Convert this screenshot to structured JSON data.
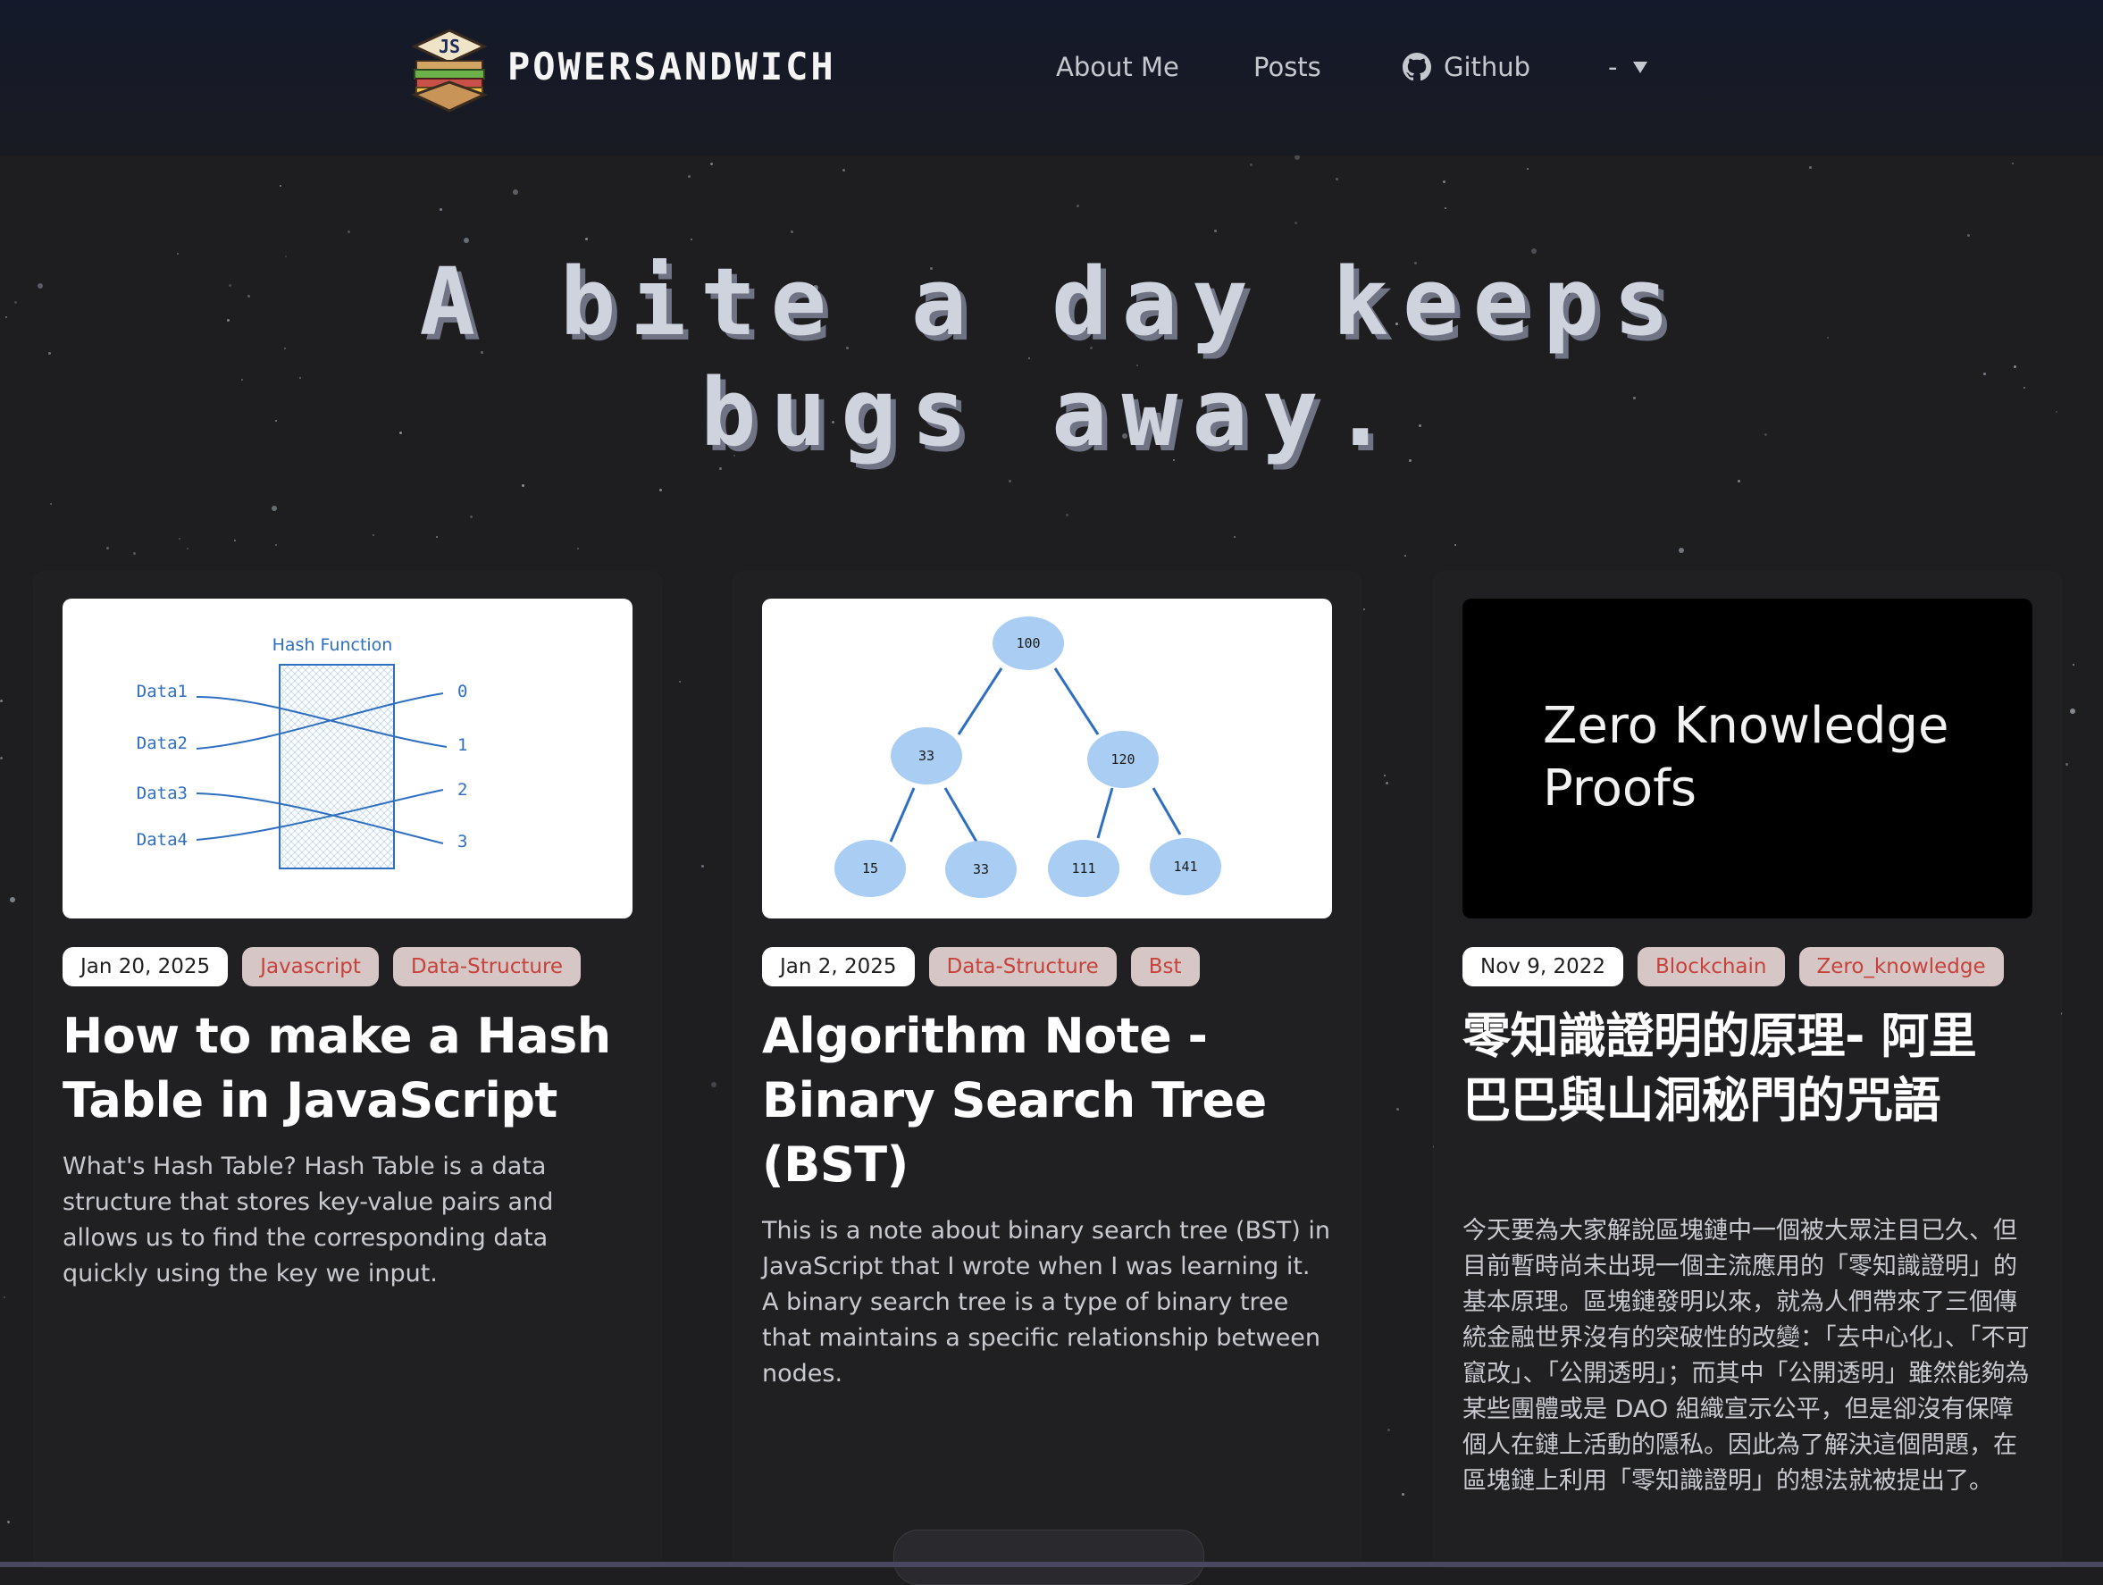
{
  "header": {
    "brand": "POWERSANDWICH",
    "logo_text": "JS",
    "nav": {
      "about": "About Me",
      "posts": "Posts",
      "github": "Github",
      "theme": "-"
    }
  },
  "hero": {
    "line1": "A bite a day keeps",
    "line2": "bugs away."
  },
  "cards": [
    {
      "date": "Jan 20, 2025",
      "tags": [
        "Javascript",
        "Data-Structure"
      ],
      "title": "How to make a Hash Table in JavaScript",
      "description": "What's Hash Table? Hash Table is a data structure that stores key-value pairs and allows us to find the corresponding data quickly using the key we input.",
      "image": {
        "heading": "Hash Function",
        "keys": [
          "Data1",
          "Data2",
          "Data3",
          "Data4"
        ],
        "indexes": [
          "0",
          "1",
          "2",
          "3"
        ]
      }
    },
    {
      "date": "Jan 2, 2025",
      "tags": [
        "Data-Structure",
        "Bst"
      ],
      "title": "Algorithm Note - Binary Search Tree (BST)",
      "description": "This is a note about binary search tree (BST) in JavaScript that I wrote when I was learning it. A binary search tree is a type of binary tree that maintains a specific relationship between nodes.",
      "image": {
        "nodes": [
          "100",
          "33",
          "120",
          "15",
          "33",
          "111",
          "141"
        ]
      }
    },
    {
      "date": "Nov 9, 2022",
      "tags": [
        "Blockchain",
        "Zero_knowledge"
      ],
      "title": "零知識證明的原理- 阿里巴巴與山洞秘門的咒語",
      "description": "今天要為大家解說區塊鏈中一個被大眾注目已久、但目前暫時尚未出現一個主流應用的「零知識證明」的基本原理。區塊鏈發明以來，就為人們帶來了三個傳統金融世界沒有的突破性的改變：「去中心化」、「不可竄改」、「公開透明」；而其中「公開透明」雖然能夠為某些團體或是 DAO 組織宣示公平，但是卻沒有保障個人在鏈上活動的隱私。因此為了解決這個問題，在區塊鏈上利用「零知識證明」的想法就被提出了。",
      "image": {
        "text": "Zero Knowledge Proofs"
      }
    }
  ],
  "colors": {
    "background": "#1e1e21",
    "card": "#202022",
    "tag_bg": "#d6c6c6",
    "tag_text": "#c6423b",
    "diagram_blue": "#2f6fc1",
    "node_fill": "#a9cdf3"
  }
}
